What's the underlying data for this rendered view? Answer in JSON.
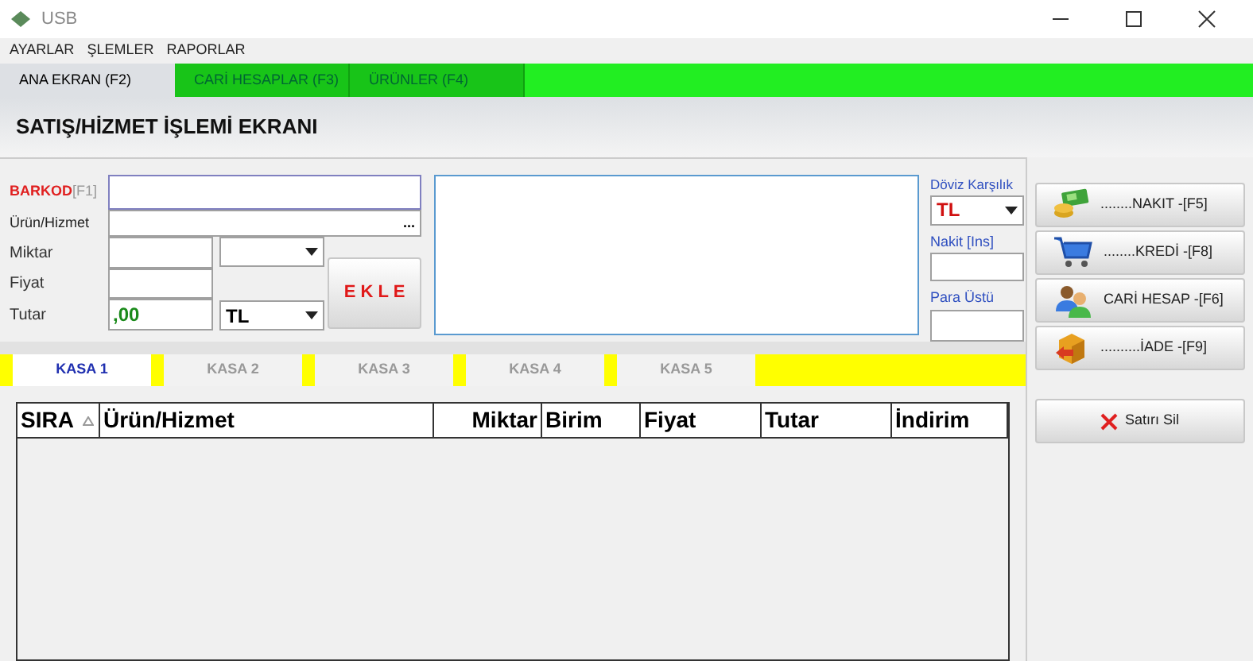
{
  "window": {
    "title": "USB"
  },
  "menu": [
    "AYARLAR",
    "ŞLEMLER",
    "RAPORLAR"
  ],
  "tabs": [
    {
      "label": "ANA EKRAN (F2)",
      "selected": true
    },
    {
      "label": "CARİ HESAPLAR (F3)",
      "selected": false
    },
    {
      "label": "ÜRÜNLER (F4)",
      "selected": false
    }
  ],
  "page_title": "SATIŞ/HİZMET İŞLEMİ EKRANI",
  "form": {
    "barcode_label": "BARKOD",
    "barcode_key": "[F1]",
    "product_label": "Ürün/Hizmet",
    "product_button": "...",
    "quantity_label": "Miktar",
    "price_label": "Fiyat",
    "total_label": "Tutar",
    "total_value": ",00",
    "currency": "TL",
    "add_button": "E K L E"
  },
  "side": {
    "exchange_label": "Döviz Karşılık",
    "exchange_currency": "TL",
    "cash_label": "Nakit [Ins]",
    "change_label": "Para Üstü"
  },
  "registers": [
    {
      "label": "KASA 1",
      "selected": true
    },
    {
      "label": "KASA 2",
      "selected": false
    },
    {
      "label": "KASA 3",
      "selected": false
    },
    {
      "label": "KASA 4",
      "selected": false
    },
    {
      "label": "KASA 5",
      "selected": false
    }
  ],
  "table": {
    "columns": [
      "SIRA",
      "Ürün/Hizmet",
      "Miktar",
      "Birim",
      "Fiyat",
      "Tutar",
      "İndirim"
    ]
  },
  "payments": [
    {
      "kind": "cash",
      "label": "........NAKIT -[F5]"
    },
    {
      "kind": "credit",
      "label": "........KREDİ -[F8]"
    },
    {
      "kind": "account",
      "label": "CARİ HESAP -[F6]"
    },
    {
      "kind": "refund",
      "label": "..........İADE -[F9]"
    }
  ],
  "delete_button": "Satırı Sil"
}
